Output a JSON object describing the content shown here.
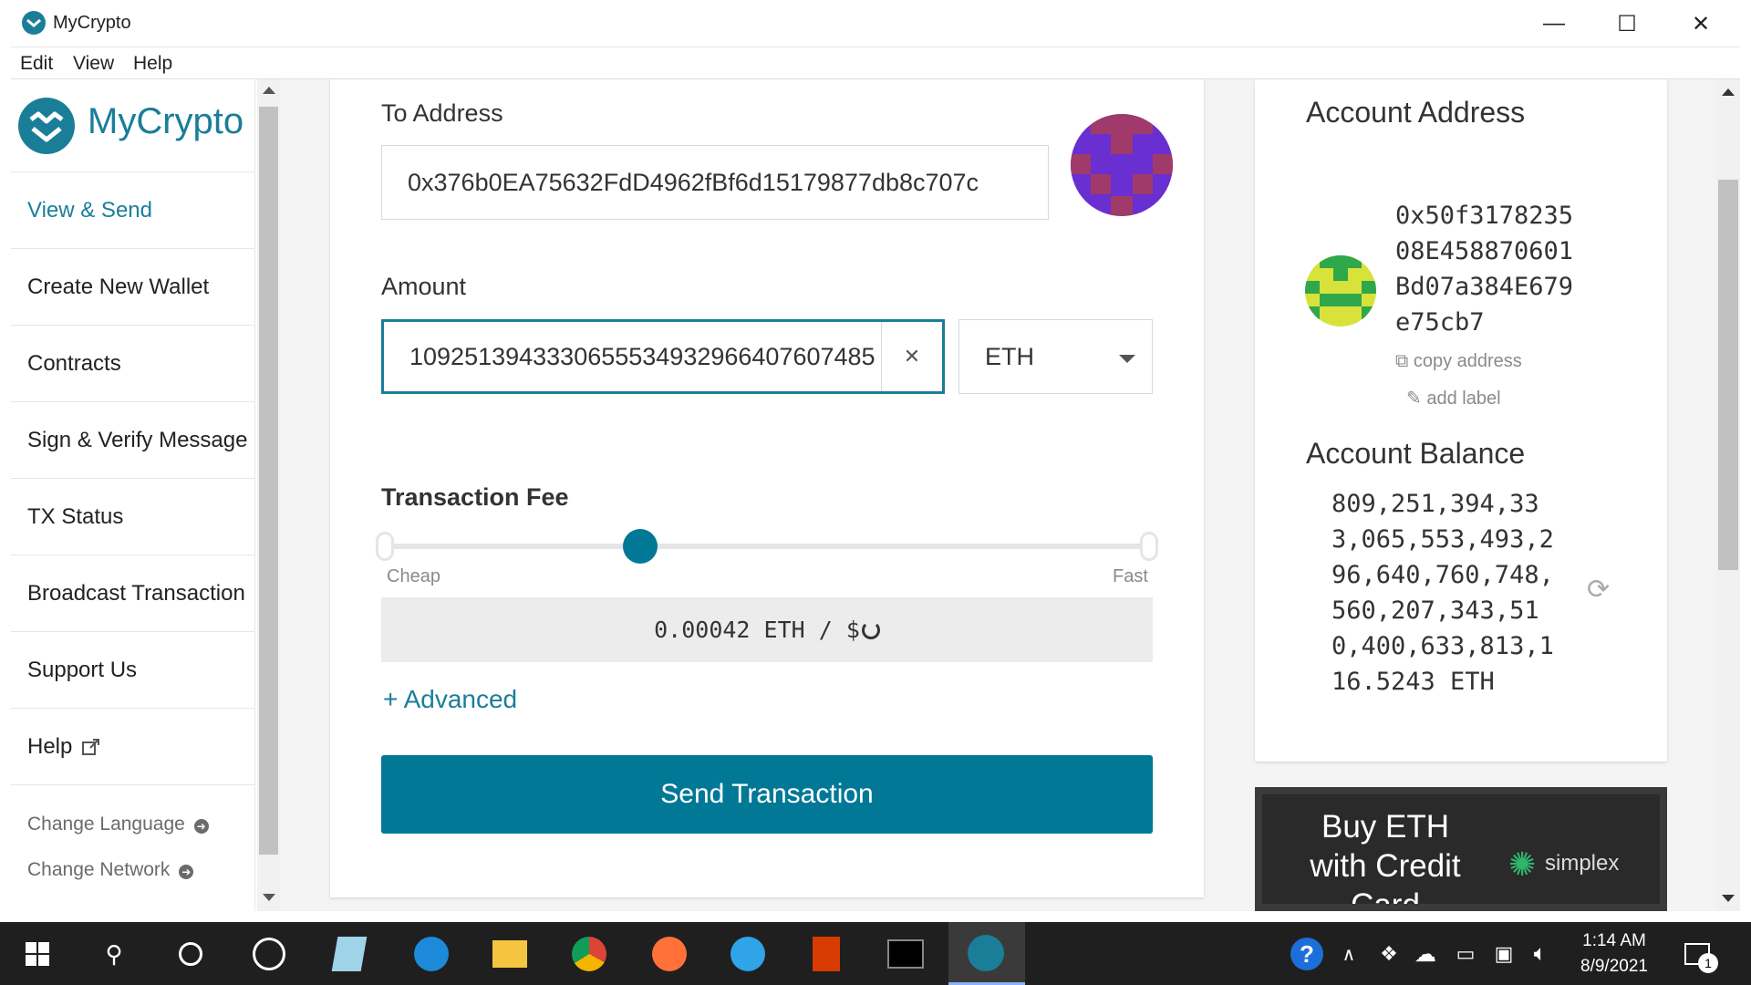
{
  "window": {
    "title": "MyCrypto",
    "minimize": "—",
    "maximize": "☐",
    "close": "✕"
  },
  "menu": {
    "items": [
      "Edit",
      "View",
      "Help"
    ]
  },
  "sidebar": {
    "logo_text": "MyCrypto",
    "items": [
      {
        "label": "View & Send",
        "active": true
      },
      {
        "label": "Create New Wallet"
      },
      {
        "label": "Contracts"
      },
      {
        "label": "Sign & Verify Message"
      },
      {
        "label": "TX Status"
      },
      {
        "label": "Broadcast Transaction"
      },
      {
        "label": "Support Us"
      },
      {
        "label": "Help"
      }
    ],
    "change_language": "Change Language",
    "change_network": "Change Network"
  },
  "form": {
    "to_address_label": "To Address",
    "to_address_value": "0x376b0EA75632FdD4962fBf6d15179877db8c707c",
    "amount_label": "Amount",
    "amount_value": "1092513943330655534932966407607485",
    "currency": "ETH",
    "fee_label": "Transaction Fee",
    "fee_cheap": "Cheap",
    "fee_fast": "Fast",
    "fee_level": 0.33,
    "fee_display": "0.00042 ETH / $",
    "advanced_label": "+ Advanced",
    "send_button": "Send Transaction"
  },
  "account": {
    "address_title": "Account Address",
    "address_lines": [
      "0x50f3178235",
      "08E458870601",
      "Bd07a384E679",
      "e75cb7"
    ],
    "copy_address": "copy address",
    "add_label": "add label",
    "balance_title": "Account Balance",
    "balance_lines": [
      "809,251,394,33",
      "3,065,553,493,2",
      "96,640,760,748,",
      "560,207,343,51",
      "0,400,633,813,1",
      "16.5243 ETH"
    ]
  },
  "promo": {
    "line1": "Buy ETH",
    "line2": "with Credit",
    "line3": "Card",
    "brand": "simplex"
  },
  "taskbar": {
    "time": "1:14 AM",
    "date": "8/9/2021",
    "notification_count": "1"
  },
  "colors": {
    "accent": "#1a7e99",
    "button": "#007896",
    "taskbar": "#1f1f1f"
  }
}
